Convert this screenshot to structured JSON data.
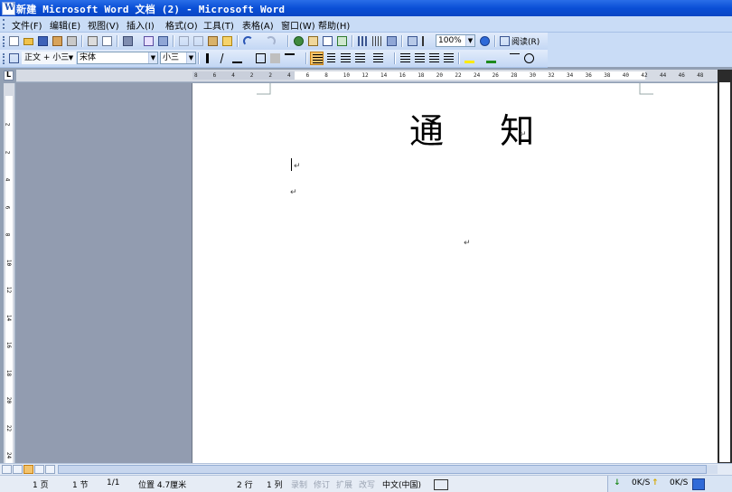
{
  "window": {
    "title": "新建 Microsoft Word 文档 (2) - Microsoft Word"
  },
  "menu": {
    "items": [
      "文件(F)",
      "编辑(E)",
      "视图(V)",
      "插入(I)",
      "格式(O)",
      "工具(T)",
      "表格(A)",
      "窗口(W)",
      "帮助(H)"
    ]
  },
  "toolbar": {
    "zoom": "100%",
    "read_label": "阅读(R)",
    "style": "正文 + 小三",
    "font": "宋体",
    "size": "小三"
  },
  "ruler": {
    "h_ticks": [
      "8",
      "6",
      "4",
      "2",
      "2",
      "4",
      "6",
      "8",
      "10",
      "12",
      "14",
      "16",
      "18",
      "20",
      "22",
      "24",
      "26",
      "28",
      "30",
      "32",
      "34",
      "36",
      "38",
      "40",
      "42",
      "44",
      "46",
      "48"
    ],
    "v_ticks": [
      "2",
      "2",
      "4",
      "6",
      "8",
      "10",
      "12",
      "14",
      "16",
      "18",
      "20",
      "22",
      "24",
      "26"
    ]
  },
  "document": {
    "title_char1": "通",
    "title_char2": "知",
    "para_mark": "↵"
  },
  "status": {
    "page": "1 页",
    "section": "1 节",
    "page_of": "1/1",
    "position": "位置 4.7厘米",
    "line": "2 行",
    "column": "1 列",
    "rec": "录制",
    "trk": "修订",
    "ext": "扩展",
    "ovr": "改写",
    "language": "中文(中国)",
    "net_down": "0K/S",
    "net_up": "0K/S"
  },
  "colors": {
    "title_bar": "#0a4fd6",
    "menu_bg": "#c9dcf6",
    "doc_bg": "#929cb0",
    "page_bg": "#ffffff",
    "selected_button": "#f3c36b"
  }
}
